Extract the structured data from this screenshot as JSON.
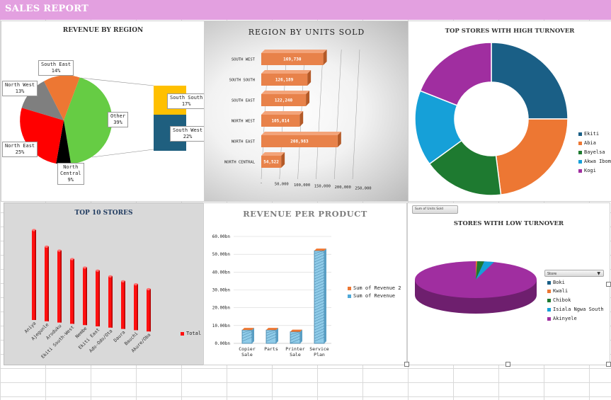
{
  "banner": {
    "title": "SALES REPORT",
    "bg": "#e3a0e0"
  },
  "revenue_by_region": {
    "title": "REVENUE BY REGION",
    "labels": {
      "south_east": [
        "South East",
        "14%"
      ],
      "north_west": [
        "North West",
        "13%"
      ],
      "north_east": [
        "North East",
        "25%"
      ],
      "north_central": [
        "North",
        "Central",
        "9%"
      ],
      "other": [
        "Other",
        "39%"
      ],
      "south_south": [
        "South South",
        "17%"
      ],
      "south_west": [
        "South West",
        "22%"
      ]
    },
    "colors": {
      "south_east": "#ed7733",
      "north_west": "#7f7f7f",
      "north_east": "#ff0000",
      "north_central": "#000000",
      "other": "#66cc44",
      "south_south": "#ffc000",
      "south_west": "#1f5f7f"
    }
  },
  "units_sold": {
    "title": "REGION BY UNITS SOLD",
    "categories": [
      "SOUTH WEST",
      "SOUTH SOUTH",
      "SOUTH EAST",
      "NORTH WEST",
      "NORTH EAST",
      "NORTH CENTRAL"
    ],
    "value_labels": [
      "169,730",
      "126,189",
      "122,240",
      "105,014",
      "208,983",
      "54,522"
    ],
    "values": [
      169730,
      126189,
      122240,
      105014,
      208983,
      54522
    ],
    "ticks": [
      "-",
      "50,000",
      "100,000",
      "150,000",
      "200,000",
      "250,000"
    ],
    "bar_color": "#e8824a"
  },
  "top_stores_high": {
    "title": "TOP STORES WITH HIGH TURNOVER",
    "legend": [
      "Ekiti",
      "Abia",
      "Bayelsa",
      "Akwa Ibom",
      "Kogi"
    ],
    "colors": [
      "#1a5f86",
      "#ed7733",
      "#1e7a30",
      "#16a0d8",
      "#a02ea0"
    ],
    "shares": [
      0.25,
      0.23,
      0.17,
      0.16,
      0.19
    ]
  },
  "top_10_stores": {
    "title": "TOP 10 STORES",
    "categories": [
      "Aniya",
      "Ajegunle",
      "Aroduku",
      "Ekiti South-West",
      "Nembe",
      "Ekiti East",
      "Ado-Odo/Ota",
      "Daura",
      "Bauchi",
      "Akure/Oba"
    ],
    "heights": [
      100,
      83,
      80,
      72,
      64,
      62,
      57,
      53,
      51,
      47
    ],
    "legend": "Total",
    "bar_color": "#ff1010"
  },
  "revenue_per_product": {
    "title": "REVENUE PER PRODUCT",
    "yticks": [
      "60.00bn",
      "50.00bn",
      "40.00bn",
      "30.00bn",
      "20.00bn",
      "10.00bn",
      "0.00bn"
    ],
    "categories": [
      [
        "Copier",
        "Sale"
      ],
      [
        "Parts",
        ""
      ],
      [
        "Printer",
        "Sale"
      ],
      [
        "Service",
        "Plan"
      ]
    ],
    "values": [
      7.5,
      7.5,
      6.5,
      52
    ],
    "ymax": 60,
    "legend": [
      "Sum of Revenue 2",
      "Sum of Revenue"
    ],
    "legend_colors": [
      "#ed7733",
      "#4fa9d8"
    ]
  },
  "low_turnover": {
    "field_button": "Sum of Units Sold",
    "title": "STORES WITH LOW TURNOVER",
    "filter_label": "Store",
    "legend": [
      "Boki",
      "Kwali",
      "Chibok",
      "Isiala Ngwa South",
      "Akinyele"
    ],
    "colors": [
      "#1a5f86",
      "#ed7733",
      "#1e7a30",
      "#16a0d8",
      "#a02ea0"
    ]
  }
}
